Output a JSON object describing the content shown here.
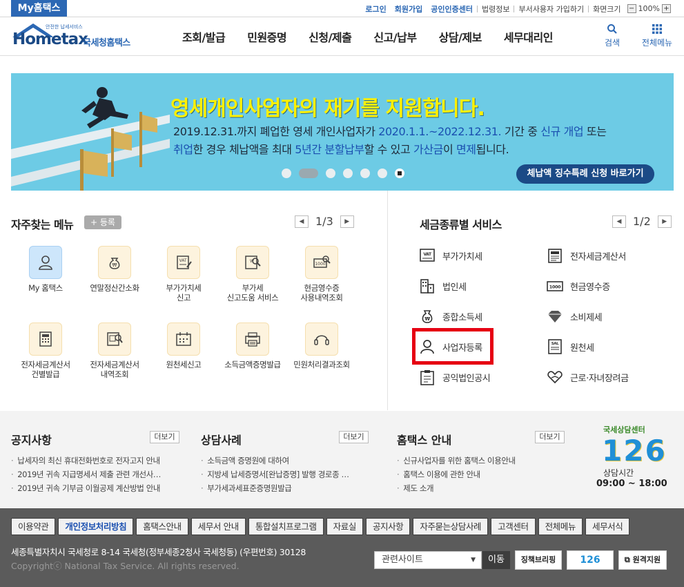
{
  "topbar": {
    "my_tab": "My홈택스",
    "links": [
      "로그인",
      "회원가입",
      "공인인증센터"
    ],
    "links2": [
      "법령정보",
      "부서사용자 가입하기"
    ],
    "screen_label": "화면크기",
    "zoom": "100%",
    "minus": "−",
    "plus": "+"
  },
  "header": {
    "logo_small": "안전한 납세서비스",
    "logo_main": "Hometax",
    "logo_sub": "국세청홈택스",
    "nav": [
      "조회/발급",
      "민원증명",
      "신청/제출",
      "신고/납부",
      "상담/제보",
      "세무대리인"
    ],
    "search": "검색",
    "allmenu": "전체메뉴"
  },
  "banner": {
    "title": "영세개인사업자의 재기를 지원합니다.",
    "line1": {
      "a": "2019.12.31.까지 폐업한 영세 개인사업자가 ",
      "b": "2020.1.1.~2022.12.31.",
      "c": " 기간 중 ",
      "d": "신규 개업",
      "e": " 또는"
    },
    "line2": {
      "a": "취업",
      "b": "한 경우 체납액을 최대 ",
      "c": "5년간 분할납부",
      "d": "할 수 있고 ",
      "e": "가산금",
      "f": "이 ",
      "g": "면제",
      "h": "됩니다."
    },
    "button": "체납액 징수특례 신청 바로가기"
  },
  "favorites": {
    "title": "자주찾는 메뉴",
    "add": "등록",
    "page": "1/3",
    "items": [
      {
        "l1": "My 홈택스",
        "l2": "",
        "icon": "user-icon"
      },
      {
        "l1": "연말정산간소화",
        "l2": "",
        "icon": "money-bag-icon"
      },
      {
        "l1": "부가가치세",
        "l2": "신고",
        "icon": "vat-icon"
      },
      {
        "l1": "부가세",
        "l2": "신고도움 서비스",
        "icon": "search-document-icon"
      },
      {
        "l1": "현금영수증",
        "l2": "사용내역조회",
        "icon": "receipt-search-icon"
      },
      {
        "l1": "전자세금계산서",
        "l2": "건별발급",
        "icon": "calculator-icon"
      },
      {
        "l1": "전자세금계산서",
        "l2": "내역조회",
        "icon": "invoice-search-icon"
      },
      {
        "l1": "원천세신고",
        "l2": "",
        "icon": "calendar-icon"
      },
      {
        "l1": "소득금액증명발급",
        "l2": "",
        "icon": "printer-icon"
      },
      {
        "l1": "민원처리결과조회",
        "l2": "",
        "icon": "headset-icon"
      }
    ]
  },
  "taxservice": {
    "title": "세금종류별 서비스",
    "page": "1/2",
    "items": [
      {
        "label": "부가가치세",
        "icon": "vat-icon"
      },
      {
        "label": "전자세금계산서",
        "icon": "invoice-icon"
      },
      {
        "label": "법인세",
        "icon": "building-icon"
      },
      {
        "label": "현금영수증",
        "icon": "cash-receipt-icon"
      },
      {
        "label": "종합소득세",
        "icon": "won-bag-icon"
      },
      {
        "label": "소비제세",
        "icon": "diamond-icon"
      },
      {
        "label": "사업자등록",
        "icon": "user-icon"
      },
      {
        "label": "원천세",
        "icon": "salary-icon"
      },
      {
        "label": "공익법인공시",
        "icon": "clipboard-icon"
      },
      {
        "label": "근로·자녀장려금",
        "icon": "heart-hand-icon"
      }
    ]
  },
  "notice": {
    "title": "공지사항",
    "more": "더보기",
    "items": [
      "납세자의 최신 휴대전화번호로 전자고지 안내",
      "2019년 귀속 지급명세서 제출 관련 개선사…",
      "2019년 귀속 기부금 이월공제 계산방법 안내"
    ]
  },
  "consult": {
    "title": "상담사례",
    "more": "더보기",
    "items": [
      "소득금액 증명원에 대하여",
      "지방세 납세증명서[완납증명] 발행 경로종 …",
      "부가세과세표준증명원발급"
    ]
  },
  "guide": {
    "title": "홈택스 안내",
    "more": "더보기",
    "items": [
      "신규사업자를 위한 홈택스 이용안내",
      "홈택스 이용에 관한 안내",
      "제도 소개"
    ]
  },
  "callcenter": {
    "name": "국세상담센터",
    "number": "126",
    "hours_label": "상담시간",
    "hours": "09:00 ~ 18:00"
  },
  "footer": {
    "links": [
      "이용약관",
      "개인정보처리방침",
      "홈택스안내",
      "세무서 안내",
      "통합설치프로그램",
      "자료실",
      "공지사항",
      "자주묻는상담사례",
      "고객센터",
      "전체메뉴",
      "세무서식"
    ],
    "address": "세종특별자치시 국세청로 8-14 국세청(정부세종2청사 국세청동) (우편번호) 30128",
    "copyright": "Copyrightⓒ National Tax Service. All rights reserved.",
    "related": "관련사이트",
    "go": "이동",
    "banner1": "징책브리핑",
    "banner2": "126",
    "remote": "원격지원"
  }
}
